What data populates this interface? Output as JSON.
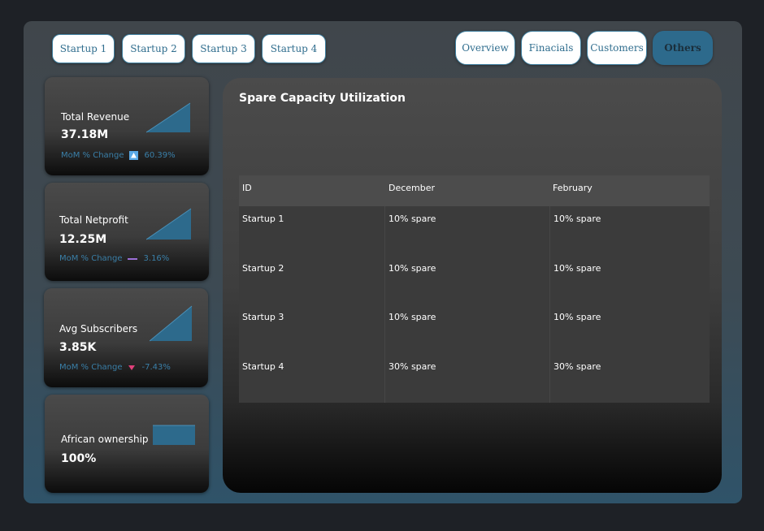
{
  "startup_tabs": [
    "Startup 1",
    "Startup 2",
    "Startup 3",
    "Startup 4"
  ],
  "nav": {
    "overview": "Overview",
    "financials": "Finacials",
    "customers": "Customers",
    "others": "Others",
    "active": "Others"
  },
  "cards": [
    {
      "title": "Total Revenue",
      "value": "37.18M",
      "mom_label": "MoM % Change",
      "mom_icon": "up-arrow-icon",
      "mom_value": "60.39%"
    },
    {
      "title": "Total Netprofit",
      "value": "12.25M",
      "mom_label": "MoM % Change",
      "mom_icon": "dash-icon",
      "mom_value": "3.16%"
    },
    {
      "title": "Avg Subscribers",
      "value": "3.85K",
      "mom_label": "MoM % Change",
      "mom_icon": "down-arrow-icon",
      "mom_value": "-7.43%"
    },
    {
      "title": "African ownership",
      "value": "100%"
    }
  ],
  "table": {
    "title": "Spare Capacity Utilization",
    "columns": [
      "ID",
      "December",
      "February"
    ],
    "rows": [
      [
        "Startup 1",
        "10% spare",
        "10% spare"
      ],
      [
        "Startup 2",
        "10% spare",
        "10% spare"
      ],
      [
        "Startup 3",
        "10% spare",
        "10% spare"
      ],
      [
        "Startup 4",
        "30% spare",
        "30% spare"
      ]
    ]
  },
  "colors": {
    "accent": "#2d6a8c",
    "up": "#5aa9e6",
    "flat": "#9b6fd6",
    "down": "#e0407a"
  }
}
